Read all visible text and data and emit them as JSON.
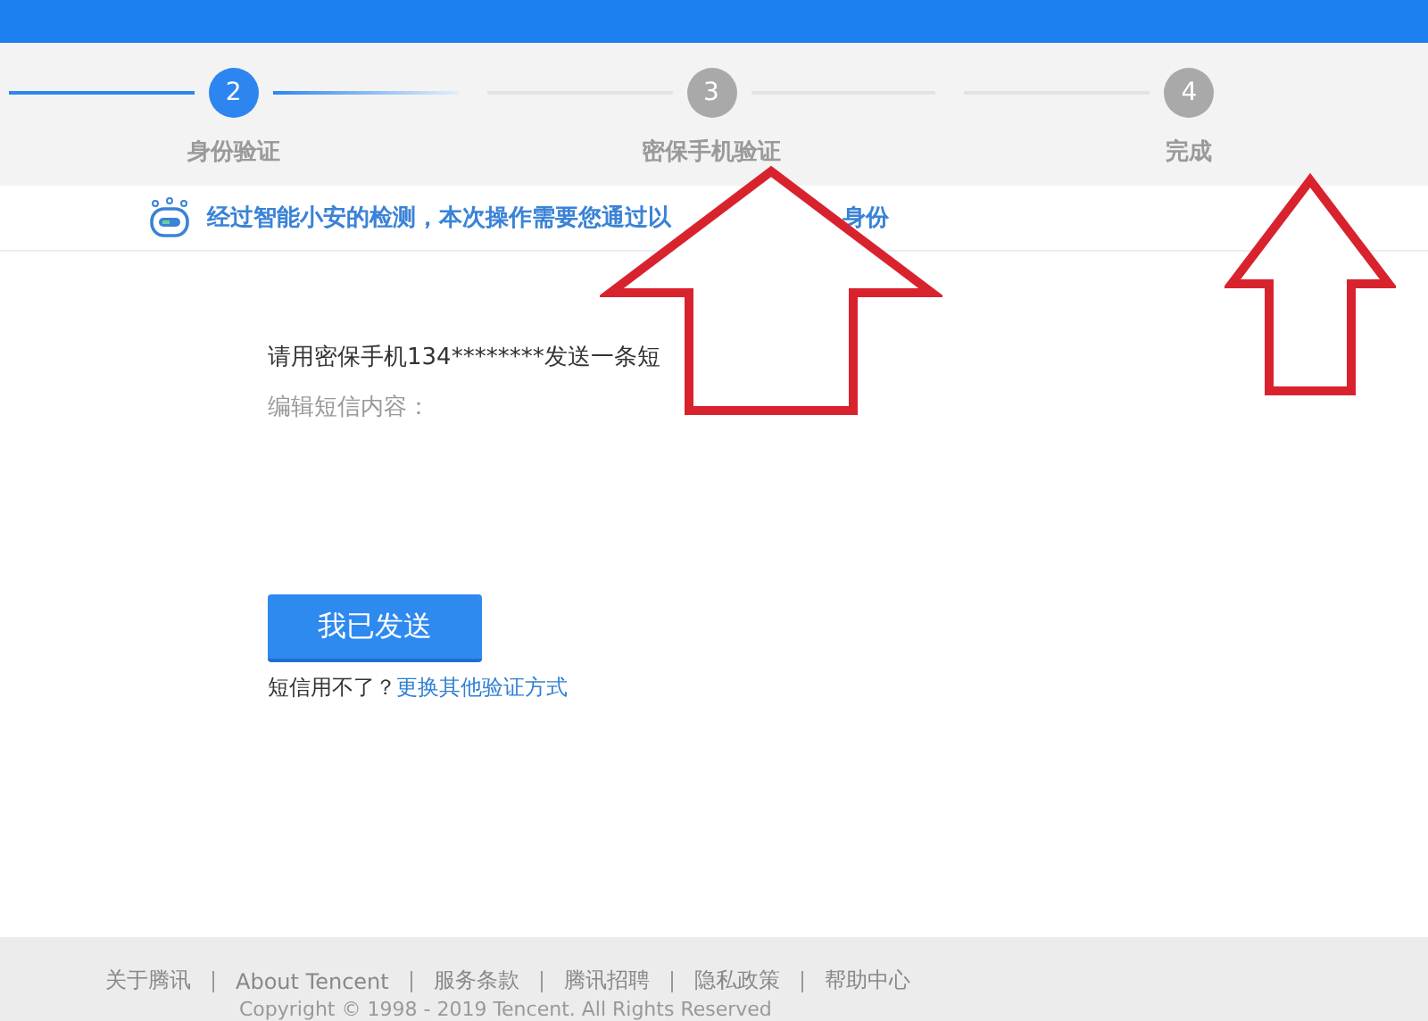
{
  "steps": [
    {
      "number": "2",
      "label": "身份验证",
      "active": true
    },
    {
      "number": "3",
      "label": "密保手机验证",
      "active": false
    },
    {
      "number": "4",
      "label": "完成",
      "active": false
    }
  ],
  "notice": {
    "parts": [
      "经过智能小安的检测，本次操作需要您通过以",
      "身份"
    ]
  },
  "instruction": "请用密保手机134********发送一条短",
  "sms_label": "编辑短信内容：",
  "send_button": "我已发送",
  "alternative": {
    "text": "短信用不了？",
    "link": "更换其他验证方式"
  },
  "footer": {
    "links": [
      "关于腾讯",
      "About Tencent",
      "服务条款",
      "腾讯招聘",
      "隐私政策",
      "帮助中心"
    ],
    "copyright": "Copyright © 1998 - 2019 Tencent. All Rights Reserved"
  },
  "annotations": [
    {
      "kind": "arrow"
    },
    {
      "kind": "arrow"
    }
  ]
}
